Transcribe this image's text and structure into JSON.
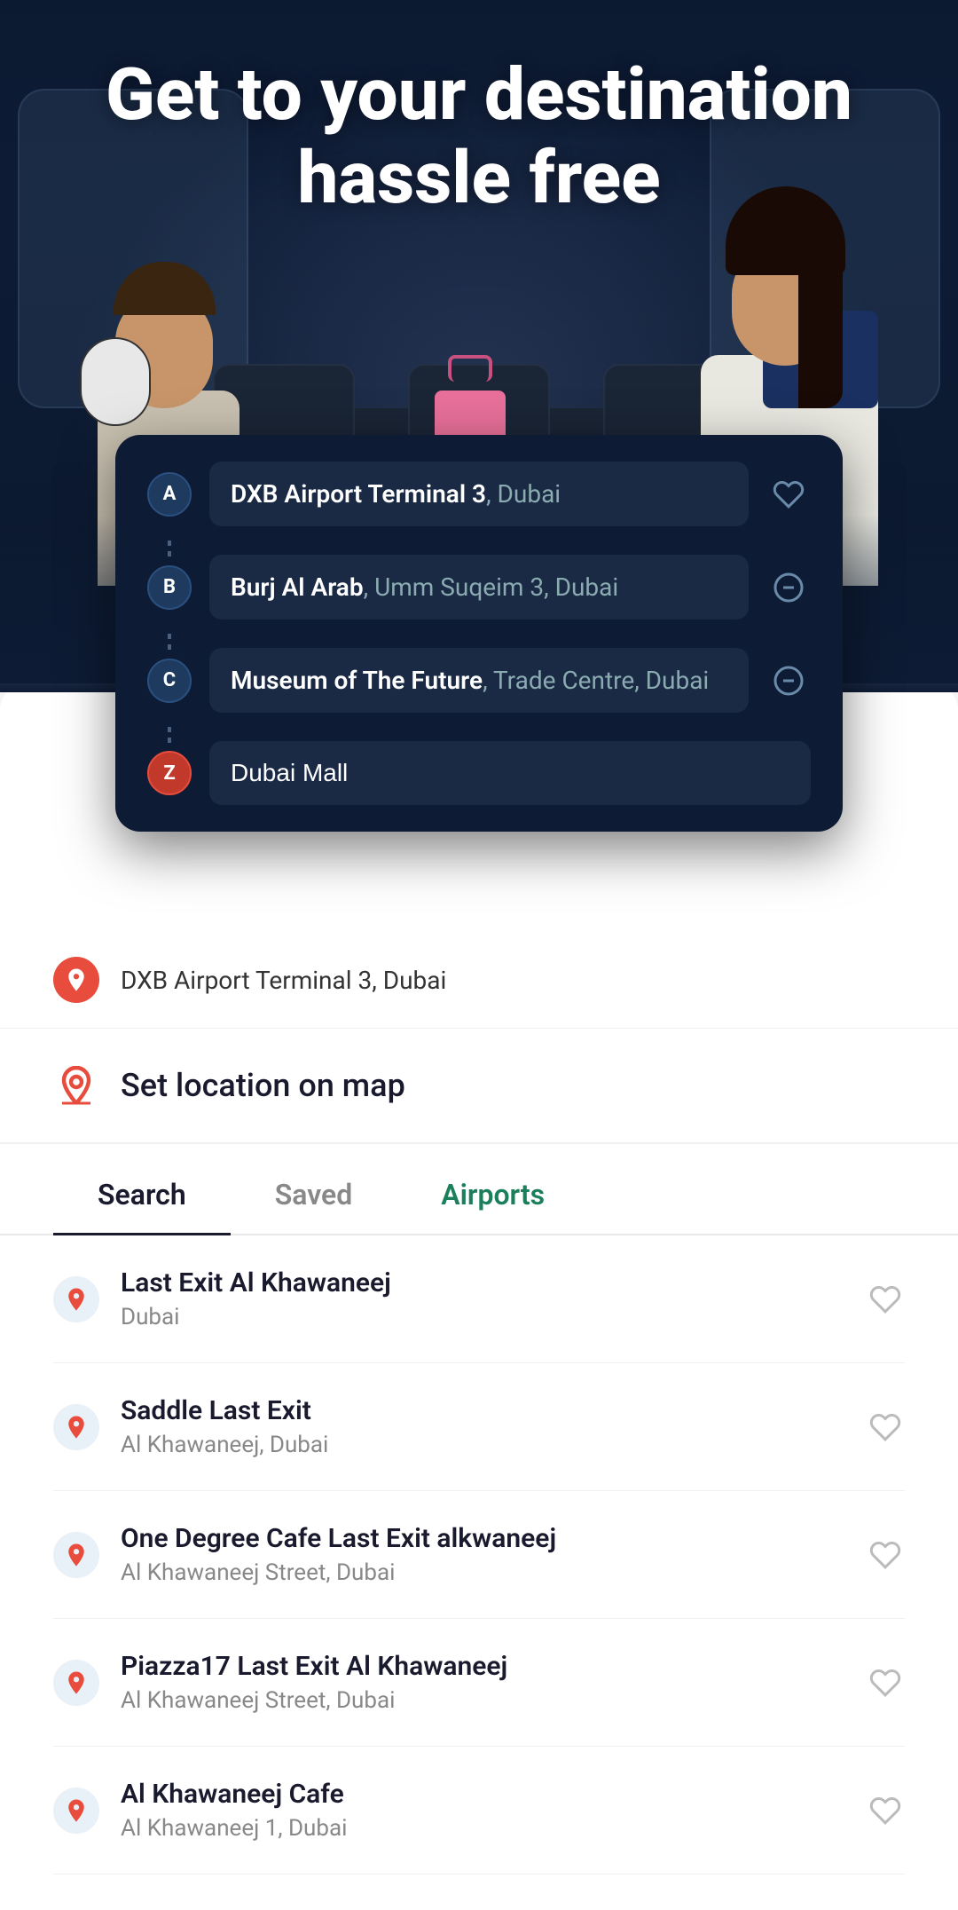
{
  "hero": {
    "title_line1": "Get to your destination",
    "title_line2": "hassle free"
  },
  "route_card": {
    "stops": [
      {
        "badge": "A",
        "badge_type": "letter",
        "main_name": "DXB Airport Terminal 3",
        "sub_name": "Dubai",
        "has_favorite": true,
        "has_remove": false
      },
      {
        "badge": "B",
        "badge_type": "letter",
        "main_name": "Burj Al Arab",
        "sub_name": "Umm Suqeim 3, Dubai",
        "has_favorite": false,
        "has_remove": true
      },
      {
        "badge": "C",
        "badge_type": "letter",
        "main_name": "Museum of The Future",
        "sub_name": "Trade Centre, Dubai",
        "has_favorite": false,
        "has_remove": true
      },
      {
        "badge": "Z",
        "badge_type": "z",
        "input_value": "Dubai Mall",
        "is_input": true,
        "has_favorite": false,
        "has_remove": false
      }
    ]
  },
  "previous_location": {
    "text": "DXB Airport Terminal 3, Dubai"
  },
  "set_location": {
    "label": "Set location on map"
  },
  "tabs": [
    {
      "label": "Search",
      "active": true,
      "color": "dark"
    },
    {
      "label": "Saved",
      "active": false,
      "color": "dark"
    },
    {
      "label": "Airports",
      "active": false,
      "color": "green"
    }
  ],
  "results": [
    {
      "name": "Last Exit Al Khawaneej",
      "address": "Dubai"
    },
    {
      "name": "Saddle Last Exit",
      "address": "Al Khawaneej, Dubai"
    },
    {
      "name": "One Degree Cafe Last Exit alkwaneej",
      "address": "Al Khawaneej Street, Dubai"
    },
    {
      "name": "Piazza17 Last Exit Al Khawaneej",
      "address": "Al Khawaneej Street, Dubai"
    },
    {
      "name": "Al Khawaneej Cafe",
      "address": "Al Khawaneej 1, Dubai"
    }
  ],
  "colors": {
    "primary_dark": "#0d1b35",
    "accent_red": "#e74c3c",
    "accent_green": "#1a7f5a",
    "bg_light": "#f5f5f5",
    "white": "#ffffff"
  }
}
